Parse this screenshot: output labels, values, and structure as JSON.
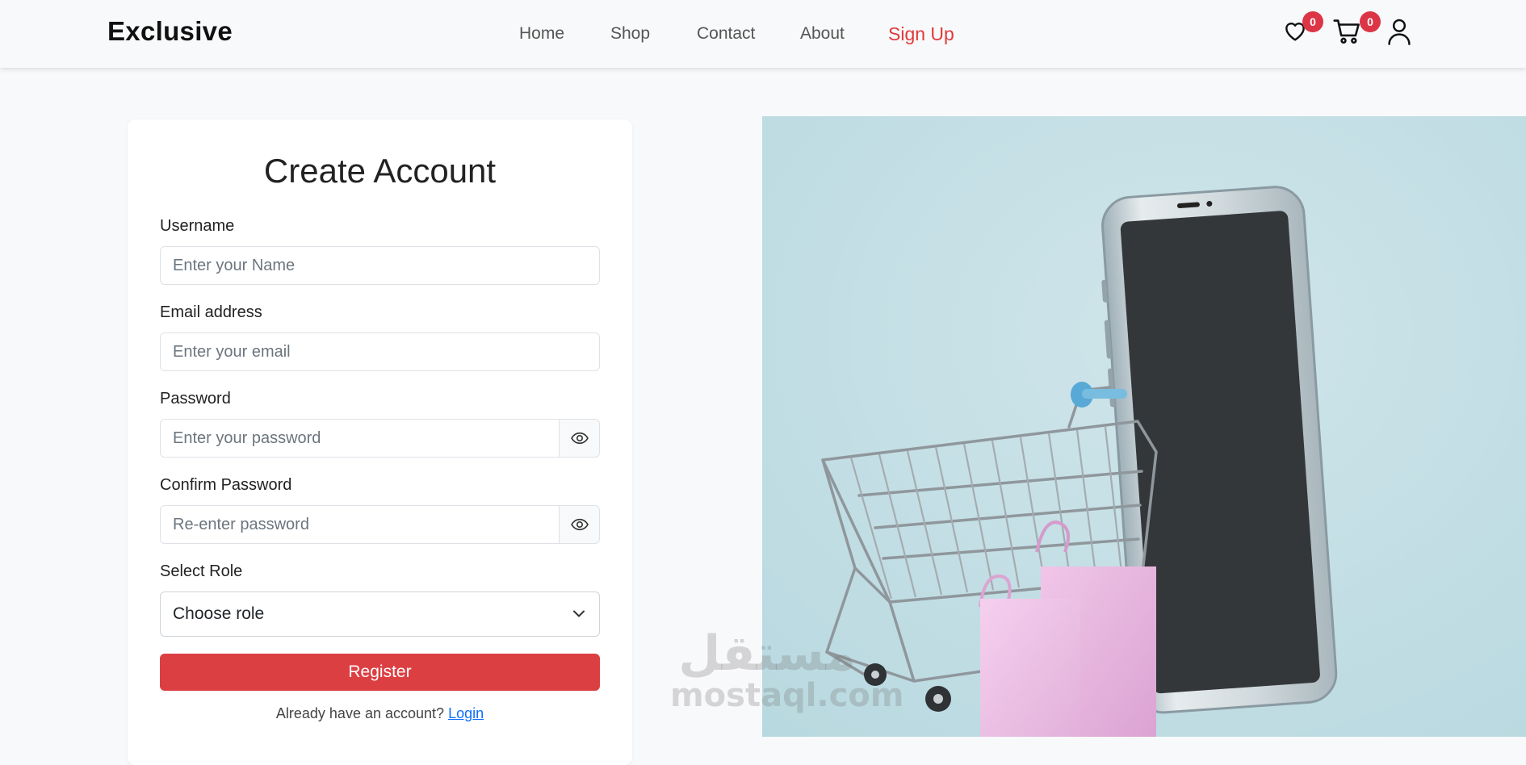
{
  "header": {
    "brand": "Exclusive",
    "nav": [
      {
        "label": "Home",
        "active": false
      },
      {
        "label": "Shop",
        "active": false
      },
      {
        "label": "Contact",
        "active": false
      },
      {
        "label": "About",
        "active": false
      },
      {
        "label": "Sign Up",
        "active": true
      }
    ],
    "wishlist_count": "0",
    "cart_count": "0",
    "icons": [
      "heart-icon",
      "cart-icon",
      "user-icon"
    ],
    "accent_color": "#e03a3a",
    "badge_color": "#dc3545"
  },
  "form": {
    "title": "Create Account",
    "username": {
      "label": "Username",
      "placeholder": "Enter your Name",
      "value": ""
    },
    "email": {
      "label": "Email address",
      "placeholder": "Enter your email",
      "value": ""
    },
    "password": {
      "label": "Password",
      "placeholder": "Enter your password",
      "value": ""
    },
    "confirm_password": {
      "label": "Confirm Password",
      "placeholder": "Re-enter password",
      "value": ""
    },
    "role": {
      "label": "Select Role",
      "selected": "Choose role"
    },
    "register_label": "Register",
    "register_color": "#dc3f42",
    "login_prompt": "Already have an account?",
    "login_link": "Login"
  },
  "watermark": {
    "arabic": "مستقل",
    "latin": "mostaql.com"
  }
}
